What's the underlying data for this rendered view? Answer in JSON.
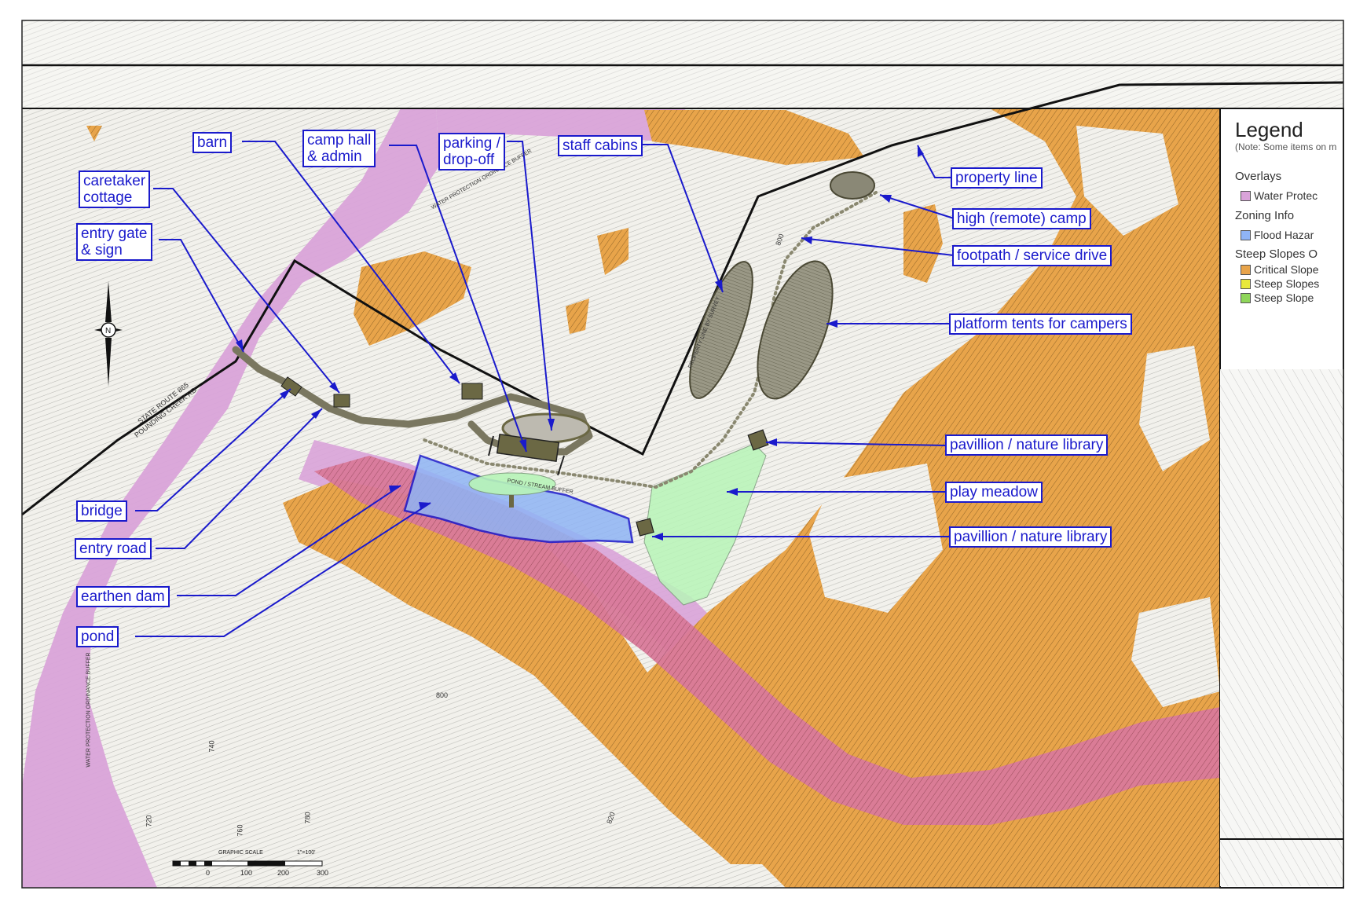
{
  "callouts": {
    "barn": "barn",
    "camp_hall_1": "camp hall",
    "camp_hall_2": "& admin",
    "parking_1": "parking /",
    "parking_2": "drop-off",
    "staff_cabins": "staff cabins",
    "caretaker_1": "caretaker",
    "caretaker_2": "cottage",
    "entry_gate_1": "entry gate",
    "entry_gate_2": "& sign",
    "property_line": "property line",
    "high_camp": "high (remote) camp",
    "footpath": "footpath / service drive",
    "platform_tents": "platform tents for campers",
    "pavillion_upper": "pavillion / nature library",
    "play_meadow": "play meadow",
    "pavillion_lower": "pavillion / nature library",
    "bridge": "bridge",
    "entry_road": "entry road",
    "earthen_dam": "earthen dam",
    "pond": "pond"
  },
  "legend": {
    "title": "Legend",
    "note": "(Note: Some items on m",
    "overlays_heading": "Overlays",
    "water_protection": "Water Protec",
    "zoning_heading": "Zoning Info",
    "flood_hazard": "Flood Hazar",
    "steep_heading": "Steep Slopes O",
    "critical_slope": "Critical Slope",
    "steep_slope_yellow": "Steep Slopes",
    "steep_slope_green": "Steep Slope"
  },
  "map_labels": {
    "state_route": "STATE ROUTE 865",
    "road_name": "POUNDING CREEK RD",
    "water_buffer_top": "WATER PROTECTION ORDINANCE BUFFER",
    "water_buffer_left": "WATER PROTECTION ORDINANCE BUFFER",
    "property_survey": "PROPERTY LINE BY SURVEY",
    "pond_buffer": "POND / STREAM BUFFER",
    "contour_800_a": "800",
    "contour_800_b": "800",
    "contour_720": "720",
    "contour_740": "740",
    "contour_760": "760",
    "contour_780": "780",
    "contour_820": "820"
  },
  "scale_bar": {
    "title": "GRAPHIC SCALE",
    "ratio": "1\"=100'",
    "ticks": [
      "0",
      "100",
      "200",
      "300"
    ]
  },
  "colors": {
    "water_protection": "#d9a3d9",
    "critical_slope": "#e8a44a",
    "flood_hazard": "#8fb4f5",
    "play_meadow": "#b8f5b8",
    "structure": "#6b6844",
    "callout_blue": "#1a1acc",
    "steep_yellow": "#e8e83a",
    "steep_green": "#8fd65a"
  },
  "icons": {
    "north_arrow": "north-arrow-icon"
  }
}
